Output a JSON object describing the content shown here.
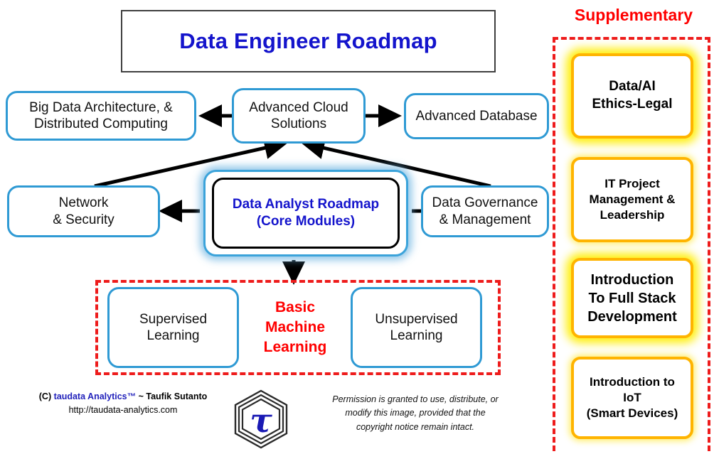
{
  "title": {
    "text": "Data Engineer Roadmap",
    "color": "#1414cc"
  },
  "diagram": {
    "tier1": [
      {
        "id": "big-data",
        "label_lines": [
          "Big Data Architecture, &",
          "Distributed Computing"
        ]
      },
      {
        "id": "advanced-cloud",
        "label_lines": [
          "Advanced Cloud",
          "Solutions"
        ]
      },
      {
        "id": "advanced-database",
        "label_lines": [
          "Advanced Database"
        ]
      }
    ],
    "tier2": [
      {
        "id": "network-security",
        "label_lines": [
          "Network",
          "& Security"
        ]
      },
      {
        "id": "data-governance",
        "label_lines": [
          "Data Governance",
          "& Management"
        ]
      }
    ],
    "core": {
      "id": "data-analyst-roadmap",
      "line1": "Data Analyst Roadmap",
      "line2": "(Core Modules)",
      "color": "#1414cc"
    },
    "basic_ml": {
      "label_lines": [
        "Basic",
        "Machine",
        "Learning"
      ],
      "color": "#ff0000",
      "boxes": [
        {
          "id": "supervised-learning",
          "label_lines": [
            "Supervised",
            "Learning"
          ]
        },
        {
          "id": "unsupervised-learning",
          "label_lines": [
            "Unsupervised",
            "Learning"
          ]
        }
      ]
    },
    "node_border_color": "#2f9ad4",
    "arrow_color": "#000000",
    "dashed_color": "#ee1c1c"
  },
  "supplementary": {
    "heading": "Supplementary",
    "heading_color": "#ff0000",
    "border_color": "#ffb400",
    "items": [
      {
        "id": "data-ai-ethics-legal",
        "label_lines": [
          "Data/AI",
          "Ethics-Legal"
        ],
        "font_size": "19px",
        "glow": "strong"
      },
      {
        "id": "it-project-management",
        "label_lines": [
          "IT Project",
          "Management &",
          "Leadership"
        ],
        "font_size": "17px",
        "glow": "soft"
      },
      {
        "id": "full-stack-development",
        "label_lines": [
          "Introduction",
          "To Full Stack",
          "Development"
        ],
        "font_size": "20px",
        "glow": "strong"
      },
      {
        "id": "introduction-to-iot",
        "label_lines": [
          "Introduction to",
          "IoT",
          "(Smart Devices)"
        ],
        "font_size": "17px",
        "glow": "soft"
      }
    ]
  },
  "footer": {
    "copyright_prefix": "(C) ",
    "brand": "taudata Analytics™",
    "copyright_suffix": " ~ Taufik Sutanto",
    "url": "http://taudata-analytics.com",
    "logo_glyph": "τ",
    "permission_lines": [
      "Permission is granted to use, distribute, or",
      "modify this image, provided that the",
      "copyright notice remain intact."
    ]
  }
}
